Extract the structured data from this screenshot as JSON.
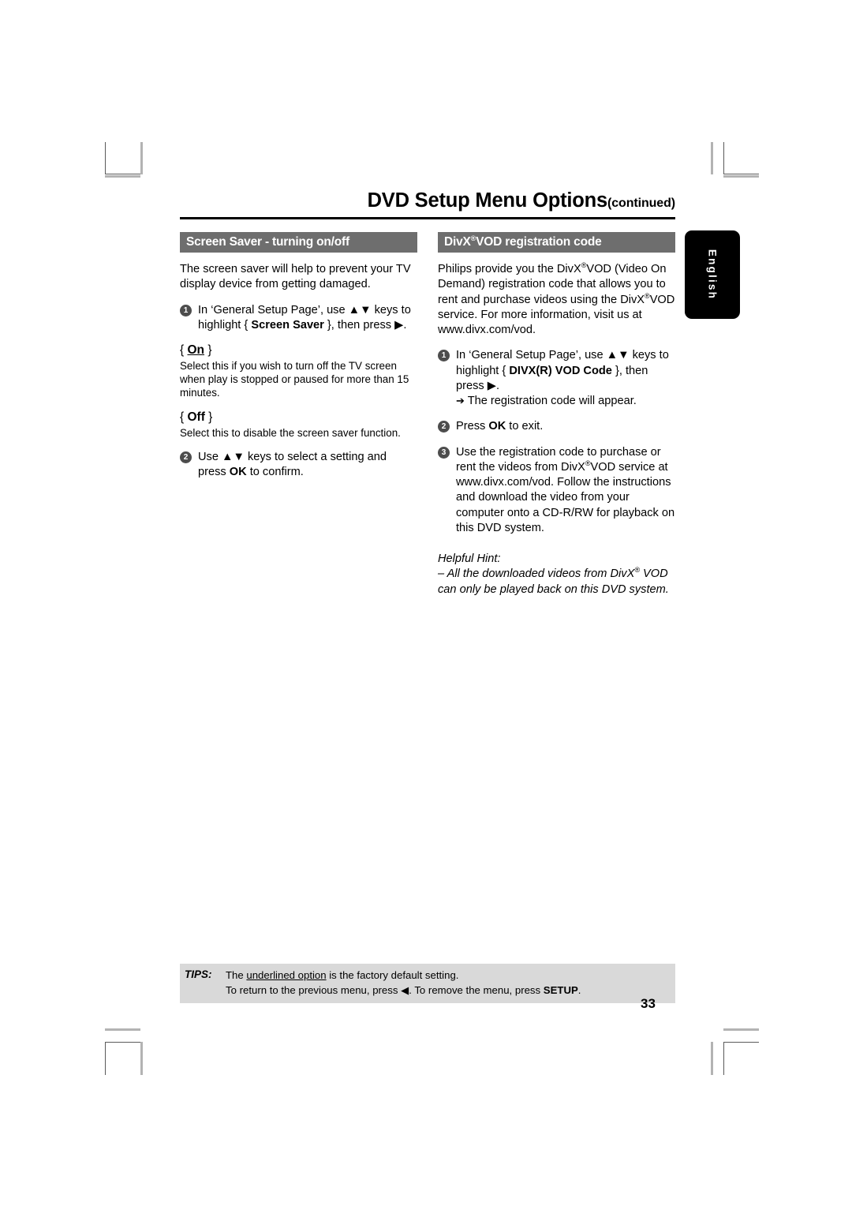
{
  "header": {
    "title_main": "DVD Setup Menu Options",
    "title_continued": "(continued)"
  },
  "side_tab": {
    "label": "English"
  },
  "left_column": {
    "section_title": "Screen Saver - turning on/off",
    "intro": "The screen saver will help to prevent your TV display device from getting damaged.",
    "step1": {
      "number": "1",
      "text_before": "In ‘General Setup Page’, use ▲▼ keys to highlight { ",
      "bold_term": "Screen Saver",
      "text_after": " }, then press ▶."
    },
    "option_on": {
      "brace_open": "{ ",
      "label": "On",
      "brace_close": " }",
      "description": "Select this if you wish to turn off the TV screen when play is stopped or paused for more than 15 minutes."
    },
    "option_off": {
      "brace_open": "{ ",
      "label": "Off",
      "brace_close": " }",
      "description": "Select this to disable the screen saver function."
    },
    "step2": {
      "number": "2",
      "text_before": "Use ▲▼ keys to select a setting and press ",
      "bold_term": "OK",
      "text_after": " to confirm."
    }
  },
  "right_column": {
    "section_title_pre": "DivX",
    "section_title_reg": "®",
    "section_title_post": "VOD registration code",
    "intro_line1": "Philips provide you the DivX",
    "intro_reg": "®",
    "intro_line1b": "VOD",
    "intro_rest_a": "(Video On Demand) registration code that allows you to rent and purchase videos using the DivX",
    "intro_rest_b": "VOD service. For more information, visit us at www.divx.com/vod.",
    "step1": {
      "number": "1",
      "text_before": "In ‘General Setup Page’, use ▲▼ keys to highlight { ",
      "bold_term": "DIVX(R) VOD Code",
      "text_after": " }, then press ▶.",
      "result_arrow": "➔",
      "result_text": "The registration code will appear."
    },
    "step2": {
      "number": "2",
      "text_before": "Press ",
      "bold_term": "OK",
      "text_after": " to exit."
    },
    "step3": {
      "number": "3",
      "text_a": "Use the registration code to purchase or rent the videos from DivX",
      "reg": "®",
      "text_b": "VOD service at www.divx.com/vod.  Follow the instructions and download the video from your computer onto a CD-R/RW for playback on this DVD system."
    },
    "helpful_hint": {
      "heading": "Helpful Hint:",
      "body_a": "– All the downloaded videos from DivX",
      "reg": "®",
      "body_b": " VOD can only be played back on this DVD system."
    }
  },
  "footer": {
    "tips_label": "TIPS:",
    "line1_pre": "The ",
    "line1_underlined": "underlined option",
    "line1_post": " is the factory default setting.",
    "line2_pre": "To return to the previous menu, press ◀.  To remove the menu, press ",
    "line2_bold": "SETUP",
    "line2_post": ".",
    "page_number": "33"
  },
  "colors": {
    "section_header_bg": "#6e6e6e",
    "tips_bar_bg": "#d9d9d9",
    "bullet_bg": "#4d4d4d",
    "side_tab_bg": "#000000"
  }
}
